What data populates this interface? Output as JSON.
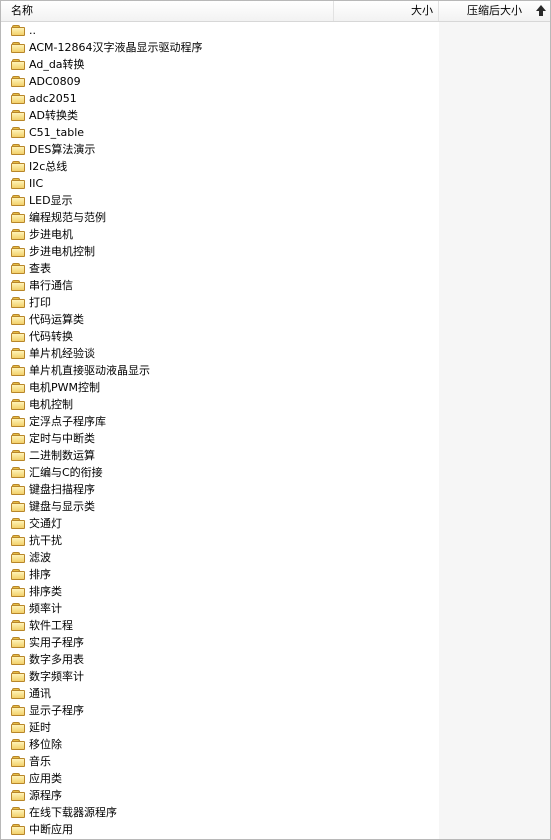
{
  "columns": {
    "name": "名称",
    "size": "大小",
    "compressed_size": "压缩后大小"
  },
  "sort": {
    "column": "compressed_size",
    "direction": "ascending"
  },
  "rows": [
    "..",
    "ACM-12864汉字液晶显示驱动程序",
    "Ad_da转换",
    "ADC0809",
    "adc2051",
    "AD转换类",
    "C51_table",
    "DES算法演示",
    "I2c总线",
    "IIC",
    "LED显示",
    "编程规范与范例",
    "步进电机",
    "步进电机控制",
    "查表",
    "串行通信",
    "打印",
    "代码运算类",
    "代码转换",
    "单片机经验谈",
    "单片机直接驱动液晶显示",
    "电机PWM控制",
    "电机控制",
    "定浮点子程序库",
    "定时与中断类",
    "二进制数运算",
    "汇编与C的衔接",
    "键盘扫描程序",
    "键盘与显示类",
    "交通灯",
    "抗干扰",
    "滤波",
    "排序",
    "排序类",
    "频率计",
    "软件工程",
    "实用子程序",
    "数字多用表",
    "数字频率计",
    "通讯",
    "显示子程序",
    "延时",
    "移位除",
    "音乐",
    "应用类",
    "源程序",
    "在线下载器源程序",
    "中断应用"
  ]
}
